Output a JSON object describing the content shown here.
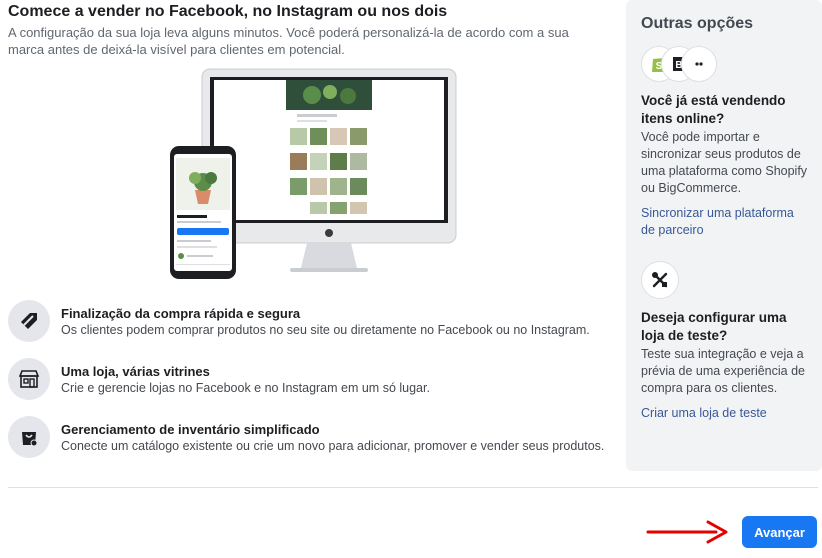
{
  "header": {
    "title": "Comece a vender no Facebook, no Instagram ou nos dois",
    "subtitle": "A configuração da sua loja leva alguns minutos. Você poderá personalizá-la de acordo com a sua marca antes de deixá-la visível para clientes em potencial."
  },
  "features": [
    {
      "icon": "tag-icon",
      "title": "Finalização da compra rápida e segura",
      "desc": "Os clientes podem comprar produtos no seu site ou diretamente no Facebook ou no Instagram."
    },
    {
      "icon": "storefront-icon",
      "title": "Uma loja, várias vitrines",
      "desc": "Crie e gerencie lojas no Facebook e no Instagram em um só lugar."
    },
    {
      "icon": "shopping-bag-icon",
      "title": "Gerenciamento de inventário simplificado",
      "desc": "Conecte um catálogo existente ou crie um novo para adicionar, promover e vender seus produtos."
    }
  ],
  "sidebar": {
    "title": "Outras opções",
    "partner": {
      "title": "Você já está vendendo itens online?",
      "desc": "Você pode importar e sincronizar seus produtos de uma plataforma como Shopify ou BigCommerce.",
      "link": "Sincronizar uma plataforma de parceiro"
    },
    "test_shop": {
      "title": "Deseja configurar uma loja de teste?",
      "desc": "Teste sua integração e veja a prévia de uma experiência de compra para os clientes.",
      "link": "Criar uma loja de teste"
    }
  },
  "footer": {
    "next_button": "Avançar"
  },
  "colors": {
    "primary": "#1877f2",
    "link": "#385898",
    "arrow": "#e60000",
    "shopify": "#95bf47"
  }
}
